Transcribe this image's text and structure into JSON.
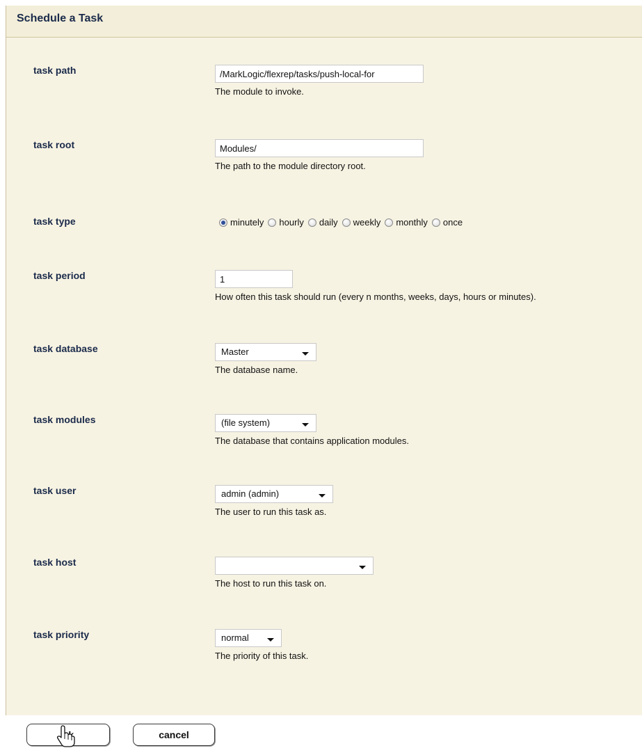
{
  "panel": {
    "title": "Schedule a Task"
  },
  "fields": {
    "task_path": {
      "label": "task path",
      "value": "/MarkLogic/flexrep/tasks/push-local-for",
      "help": "The module to invoke."
    },
    "task_root": {
      "label": "task root",
      "value": "Modules/",
      "help": "The path to the module directory root."
    },
    "task_type": {
      "label": "task type",
      "options": [
        "minutely",
        "hourly",
        "daily",
        "weekly",
        "monthly",
        "once"
      ],
      "selected": "minutely"
    },
    "task_period": {
      "label": "task period",
      "value": "1",
      "help": "How often this task should run (every n months, weeks, days, hours or minutes)."
    },
    "task_database": {
      "label": "task database",
      "value": "Master",
      "help": "The database name."
    },
    "task_modules": {
      "label": "task modules",
      "value": "(file system)",
      "help": "The database that contains application modules."
    },
    "task_user": {
      "label": "task user",
      "value": "admin (admin)",
      "help": "The user to run this task as."
    },
    "task_host": {
      "label": "task host",
      "value": "",
      "help": "The host to run this task on."
    },
    "task_priority": {
      "label": "task priority",
      "value": "normal",
      "help": "The priority of this task."
    }
  },
  "buttons": {
    "ok": "ok",
    "cancel": "cancel"
  },
  "cursor": {
    "icon": "hand-pointer-icon"
  }
}
